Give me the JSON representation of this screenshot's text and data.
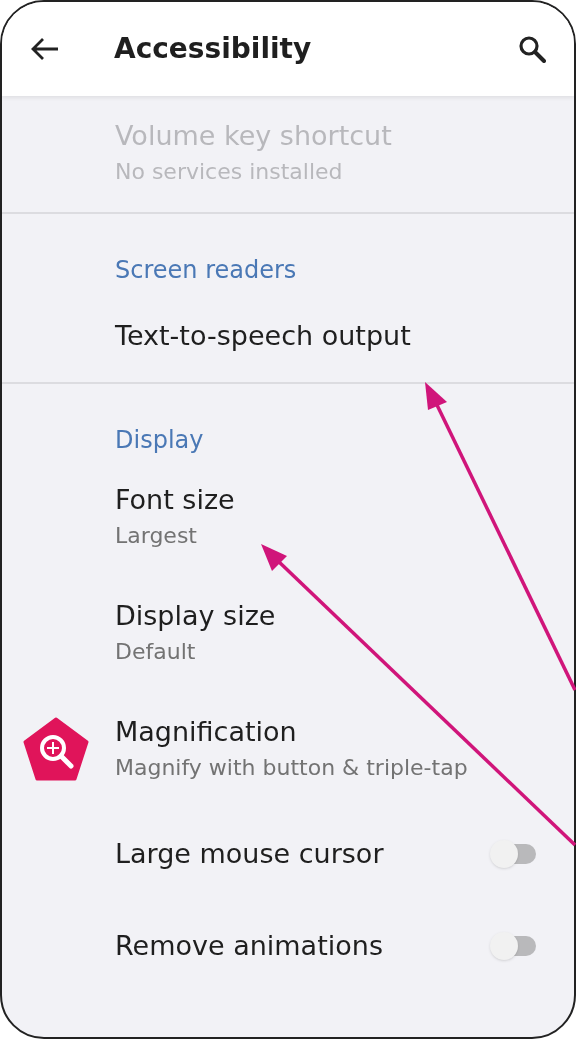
{
  "app_bar": {
    "title": "Accessibility"
  },
  "sections": [
    {
      "items": [
        {
          "kind": "item",
          "title": "Volume key shortcut",
          "subtitle": "No services installed",
          "disabled": true
        }
      ]
    },
    {
      "header": "Screen readers",
      "items": [
        {
          "kind": "item",
          "title": "Text-to-speech output",
          "disabled": false
        }
      ]
    },
    {
      "header": "Display",
      "items": [
        {
          "kind": "item",
          "title": "Font size",
          "subtitle": "Largest",
          "disabled": false
        },
        {
          "kind": "item",
          "title": "Display size",
          "subtitle": "Default",
          "disabled": false
        },
        {
          "kind": "icon_item",
          "title": "Magnification",
          "subtitle": "Magnify with button & triple-tap",
          "disabled": false
        },
        {
          "kind": "toggle",
          "title": "Large mouse cursor",
          "on": false,
          "disabled": false
        },
        {
          "kind": "toggle",
          "title": "Remove animations",
          "on": false,
          "disabled": false
        }
      ]
    }
  ]
}
